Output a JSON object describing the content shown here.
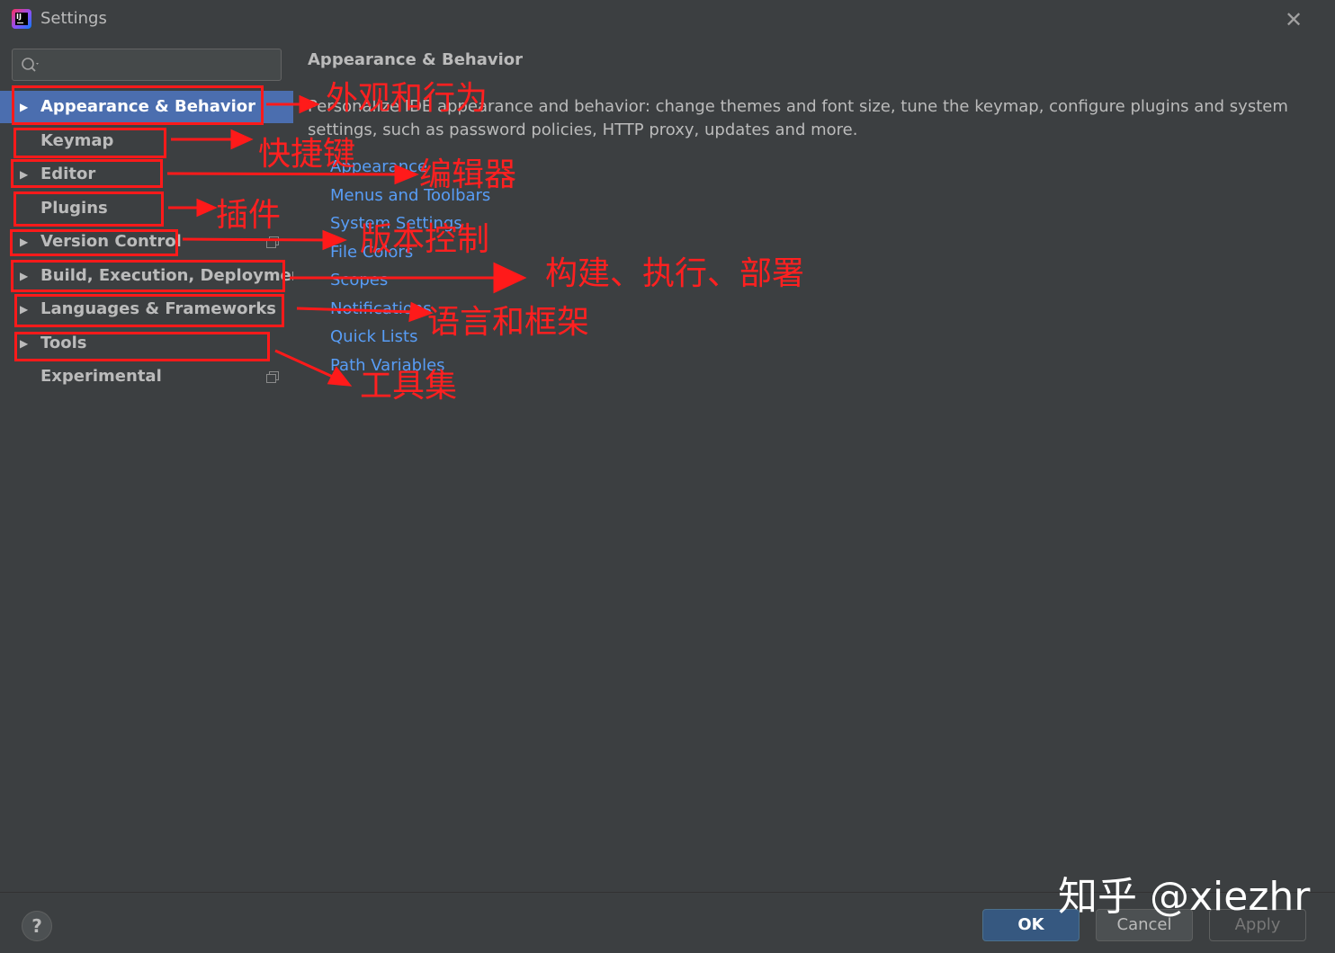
{
  "window": {
    "title": "Settings",
    "app_icon_text": "IJ"
  },
  "sidebar": {
    "search": {
      "placeholder": "",
      "value": ""
    },
    "items": [
      {
        "label": "Appearance & Behavior",
        "expandable": true,
        "selected": true,
        "project_icon": false
      },
      {
        "label": "Keymap",
        "expandable": false,
        "selected": false,
        "project_icon": false
      },
      {
        "label": "Editor",
        "expandable": true,
        "selected": false,
        "project_icon": false
      },
      {
        "label": "Plugins",
        "expandable": false,
        "selected": false,
        "project_icon": false
      },
      {
        "label": "Version Control",
        "expandable": true,
        "selected": false,
        "project_icon": true
      },
      {
        "label": "Build, Execution, Deployment",
        "expandable": true,
        "selected": false,
        "project_icon": false
      },
      {
        "label": "Languages & Frameworks",
        "expandable": true,
        "selected": false,
        "project_icon": false
      },
      {
        "label": "Tools",
        "expandable": true,
        "selected": false,
        "project_icon": false
      },
      {
        "label": "Experimental",
        "expandable": false,
        "selected": false,
        "project_icon": true
      }
    ]
  },
  "content": {
    "title": "Appearance & Behavior",
    "description": "Personalize IDE appearance and behavior: change themes and font size, tune the keymap, configure plugins and system settings, such as password policies, HTTP proxy, updates and more.",
    "links": [
      "Appearance",
      "Menus and Toolbars",
      "System Settings",
      "File Colors",
      "Scopes",
      "Notifications",
      "Quick Lists",
      "Path Variables"
    ]
  },
  "footer": {
    "help_label": "?",
    "ok_label": "OK",
    "cancel_label": "Cancel",
    "apply_label": "Apply"
  },
  "annotations": [
    "外观和行为",
    "快捷键",
    "编辑器",
    "插件",
    "版本控制",
    "构建、执行、部署",
    "语言和框架",
    "工具集"
  ],
  "watermark": "知乎 @xiezhr",
  "colors": {
    "background": "#3c3f41",
    "selection": "#4b6eaf",
    "link": "#589df6",
    "annotation": "#ff1a1a",
    "ok_button": "#365880"
  }
}
